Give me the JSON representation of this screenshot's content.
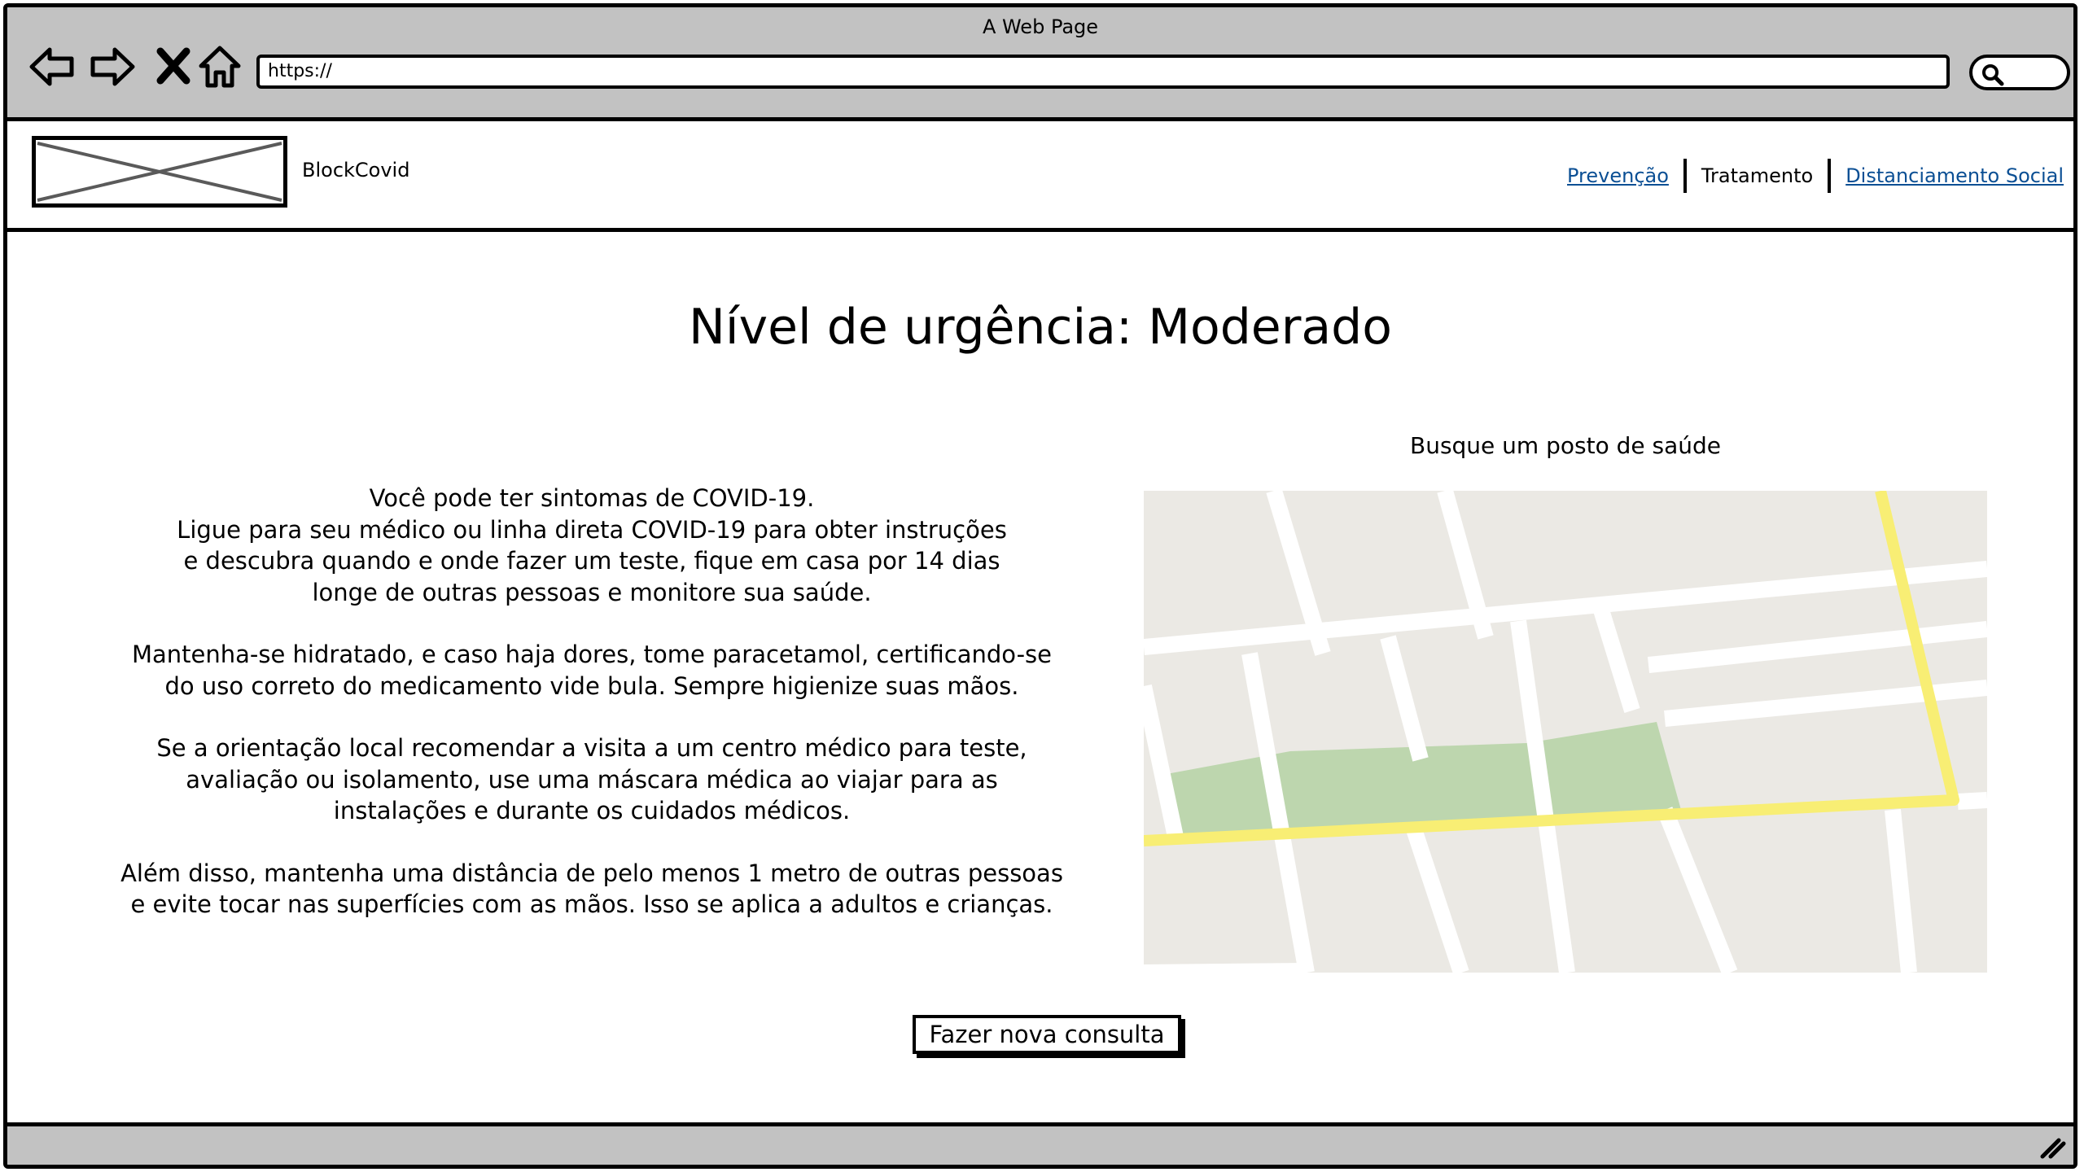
{
  "window": {
    "title": "A Web Page",
    "url": "https://"
  },
  "site": {
    "brand": "BlockCovid",
    "nav": [
      {
        "label": "Prevenção",
        "link": true
      },
      {
        "label": "Tratamento",
        "link": false
      },
      {
        "label": "Distanciamento Social",
        "link": true
      }
    ]
  },
  "main": {
    "title": "Nível de urgência: Moderado",
    "paragraphs": [
      [
        "Você pode ter sintomas de COVID-19.",
        "Ligue para seu médico ou linha direta COVID-19 para obter instruções",
        "e descubra quando e onde fazer um teste, fique em casa por 14 dias",
        "longe de outras pessoas e monitore sua saúde."
      ],
      [
        "Mantenha-se hidratado, e caso haja dores, tome paracetamol, certificando-se",
        "do uso correto do medicamento vide bula. Sempre higienize suas mãos."
      ],
      [
        "Se a orientação local recomendar a visita a um centro médico para teste,",
        "avaliação ou isolamento, use uma máscara médica ao viajar para as",
        "instalações e durante os cuidados médicos."
      ],
      [
        "Além disso, mantenha uma distância de pelo menos 1 metro de outras pessoas",
        "e evite tocar nas superfícies com as mãos. Isso se aplica a adultos e crianças."
      ]
    ],
    "map_caption": "Busque um posto de saúde",
    "cta_label": "Fazer nova consulta"
  },
  "colors": {
    "chrome": "#c2c2c2",
    "link": "#0b4f94",
    "map_bg": "#ebe9e4",
    "map_park": "#bdd6ae",
    "map_road": "#f8ee74"
  },
  "icons": [
    "back-arrow-icon",
    "forward-arrow-icon",
    "stop-icon",
    "home-icon",
    "search-icon",
    "resize-grip-icon",
    "placeholder-image-icon"
  ]
}
